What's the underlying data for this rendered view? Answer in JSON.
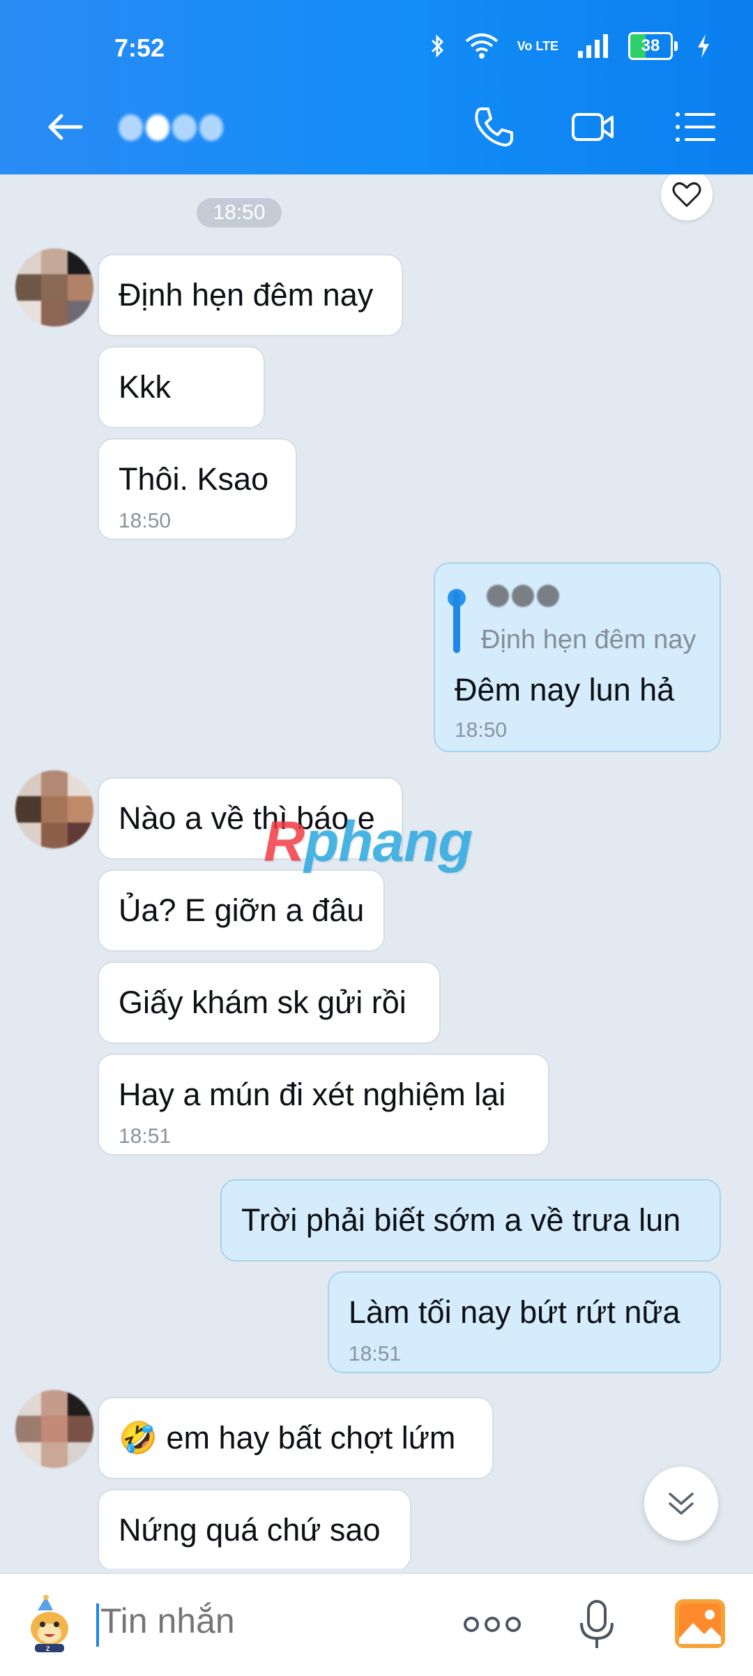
{
  "status_bar": {
    "time": "7:52",
    "battery": "38",
    "network": "Vo LTE"
  },
  "header": {
    "contact_name": ""
  },
  "chat": {
    "time_divider": "18:50",
    "messages": [
      {
        "side": "in",
        "text": "Định hẹn đêm nay"
      },
      {
        "side": "in",
        "text": "Kkk"
      },
      {
        "side": "in",
        "text": "Thôi. Ksao",
        "time": "18:50"
      },
      {
        "side": "out",
        "reply_quote": "Định hẹn đêm nay",
        "text": "Đêm nay lun hả",
        "time": "18:50"
      },
      {
        "side": "in",
        "text": "Nào a về thì báo e"
      },
      {
        "side": "in",
        "text": "Ủa? E giỡn a đâu"
      },
      {
        "side": "in",
        "text": "Giấy khám sk gửi rồi"
      },
      {
        "side": "in",
        "text": "Hay a mún đi xét nghiệm lại",
        "time": "18:51"
      },
      {
        "side": "out",
        "text": "Trời phải biết sớm a về trưa lun"
      },
      {
        "side": "out",
        "text": "Làm tối nay bứt rứt nữa",
        "time": "18:51"
      },
      {
        "side": "in",
        "text": "🤣 em hay bất chợt lứm"
      },
      {
        "side": "in",
        "text": "Nứng quá chứ sao"
      }
    ],
    "watermark": {
      "part1": "R",
      "part2": "phang"
    }
  },
  "input": {
    "placeholder": "Tin nhắn"
  },
  "colors": {
    "header": "#128cf6",
    "incoming": "#ffffff",
    "outgoing": "#d5ecfc",
    "background": "#e2e9f1"
  }
}
